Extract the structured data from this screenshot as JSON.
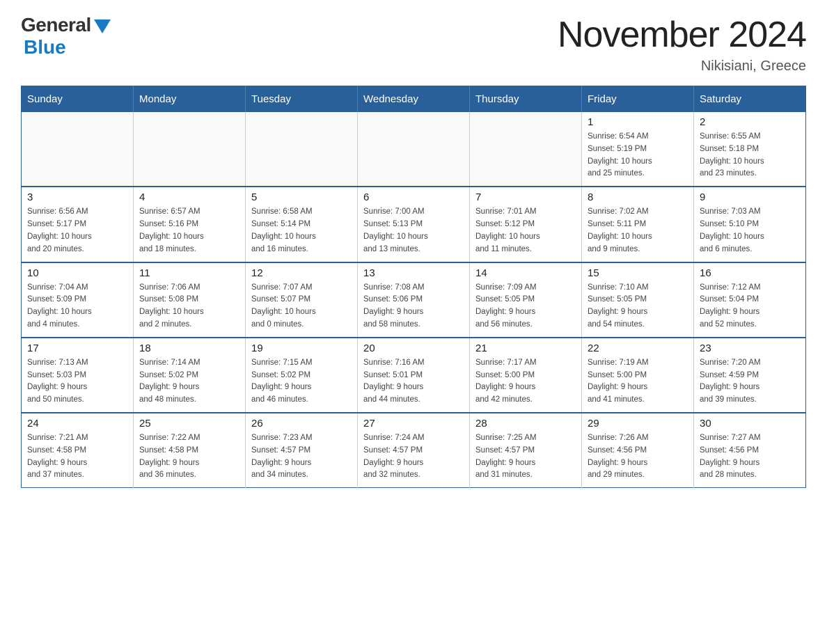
{
  "logo": {
    "general": "General",
    "blue": "Blue"
  },
  "header": {
    "title": "November 2024",
    "location": "Nikisiani, Greece"
  },
  "weekdays": [
    "Sunday",
    "Monday",
    "Tuesday",
    "Wednesday",
    "Thursday",
    "Friday",
    "Saturday"
  ],
  "weeks": [
    [
      {
        "day": "",
        "info": ""
      },
      {
        "day": "",
        "info": ""
      },
      {
        "day": "",
        "info": ""
      },
      {
        "day": "",
        "info": ""
      },
      {
        "day": "",
        "info": ""
      },
      {
        "day": "1",
        "info": "Sunrise: 6:54 AM\nSunset: 5:19 PM\nDaylight: 10 hours\nand 25 minutes."
      },
      {
        "day": "2",
        "info": "Sunrise: 6:55 AM\nSunset: 5:18 PM\nDaylight: 10 hours\nand 23 minutes."
      }
    ],
    [
      {
        "day": "3",
        "info": "Sunrise: 6:56 AM\nSunset: 5:17 PM\nDaylight: 10 hours\nand 20 minutes."
      },
      {
        "day": "4",
        "info": "Sunrise: 6:57 AM\nSunset: 5:16 PM\nDaylight: 10 hours\nand 18 minutes."
      },
      {
        "day": "5",
        "info": "Sunrise: 6:58 AM\nSunset: 5:14 PM\nDaylight: 10 hours\nand 16 minutes."
      },
      {
        "day": "6",
        "info": "Sunrise: 7:00 AM\nSunset: 5:13 PM\nDaylight: 10 hours\nand 13 minutes."
      },
      {
        "day": "7",
        "info": "Sunrise: 7:01 AM\nSunset: 5:12 PM\nDaylight: 10 hours\nand 11 minutes."
      },
      {
        "day": "8",
        "info": "Sunrise: 7:02 AM\nSunset: 5:11 PM\nDaylight: 10 hours\nand 9 minutes."
      },
      {
        "day": "9",
        "info": "Sunrise: 7:03 AM\nSunset: 5:10 PM\nDaylight: 10 hours\nand 6 minutes."
      }
    ],
    [
      {
        "day": "10",
        "info": "Sunrise: 7:04 AM\nSunset: 5:09 PM\nDaylight: 10 hours\nand 4 minutes."
      },
      {
        "day": "11",
        "info": "Sunrise: 7:06 AM\nSunset: 5:08 PM\nDaylight: 10 hours\nand 2 minutes."
      },
      {
        "day": "12",
        "info": "Sunrise: 7:07 AM\nSunset: 5:07 PM\nDaylight: 10 hours\nand 0 minutes."
      },
      {
        "day": "13",
        "info": "Sunrise: 7:08 AM\nSunset: 5:06 PM\nDaylight: 9 hours\nand 58 minutes."
      },
      {
        "day": "14",
        "info": "Sunrise: 7:09 AM\nSunset: 5:05 PM\nDaylight: 9 hours\nand 56 minutes."
      },
      {
        "day": "15",
        "info": "Sunrise: 7:10 AM\nSunset: 5:05 PM\nDaylight: 9 hours\nand 54 minutes."
      },
      {
        "day": "16",
        "info": "Sunrise: 7:12 AM\nSunset: 5:04 PM\nDaylight: 9 hours\nand 52 minutes."
      }
    ],
    [
      {
        "day": "17",
        "info": "Sunrise: 7:13 AM\nSunset: 5:03 PM\nDaylight: 9 hours\nand 50 minutes."
      },
      {
        "day": "18",
        "info": "Sunrise: 7:14 AM\nSunset: 5:02 PM\nDaylight: 9 hours\nand 48 minutes."
      },
      {
        "day": "19",
        "info": "Sunrise: 7:15 AM\nSunset: 5:02 PM\nDaylight: 9 hours\nand 46 minutes."
      },
      {
        "day": "20",
        "info": "Sunrise: 7:16 AM\nSunset: 5:01 PM\nDaylight: 9 hours\nand 44 minutes."
      },
      {
        "day": "21",
        "info": "Sunrise: 7:17 AM\nSunset: 5:00 PM\nDaylight: 9 hours\nand 42 minutes."
      },
      {
        "day": "22",
        "info": "Sunrise: 7:19 AM\nSunset: 5:00 PM\nDaylight: 9 hours\nand 41 minutes."
      },
      {
        "day": "23",
        "info": "Sunrise: 7:20 AM\nSunset: 4:59 PM\nDaylight: 9 hours\nand 39 minutes."
      }
    ],
    [
      {
        "day": "24",
        "info": "Sunrise: 7:21 AM\nSunset: 4:58 PM\nDaylight: 9 hours\nand 37 minutes."
      },
      {
        "day": "25",
        "info": "Sunrise: 7:22 AM\nSunset: 4:58 PM\nDaylight: 9 hours\nand 36 minutes."
      },
      {
        "day": "26",
        "info": "Sunrise: 7:23 AM\nSunset: 4:57 PM\nDaylight: 9 hours\nand 34 minutes."
      },
      {
        "day": "27",
        "info": "Sunrise: 7:24 AM\nSunset: 4:57 PM\nDaylight: 9 hours\nand 32 minutes."
      },
      {
        "day": "28",
        "info": "Sunrise: 7:25 AM\nSunset: 4:57 PM\nDaylight: 9 hours\nand 31 minutes."
      },
      {
        "day": "29",
        "info": "Sunrise: 7:26 AM\nSunset: 4:56 PM\nDaylight: 9 hours\nand 29 minutes."
      },
      {
        "day": "30",
        "info": "Sunrise: 7:27 AM\nSunset: 4:56 PM\nDaylight: 9 hours\nand 28 minutes."
      }
    ]
  ]
}
